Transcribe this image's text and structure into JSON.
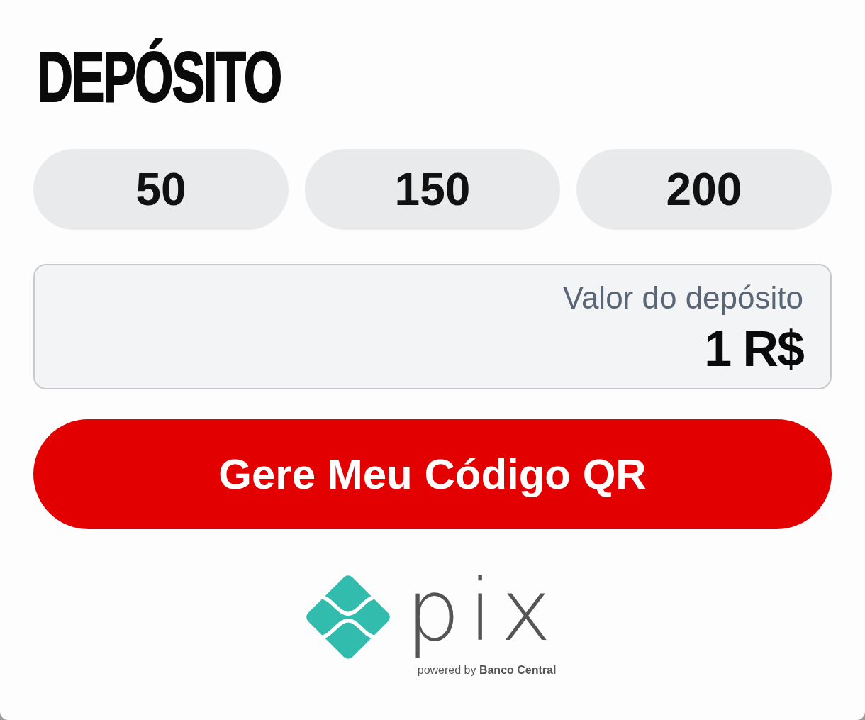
{
  "title": "DEPÓSITO",
  "amount_options": [
    {
      "label": "50",
      "selected": false
    },
    {
      "label": "150",
      "selected": false
    },
    {
      "label": "200",
      "selected": false
    }
  ],
  "amount_field": {
    "label": "Valor do depósito",
    "value": "1 R$"
  },
  "submit_button": {
    "label": "Gere Meu Código QR"
  },
  "footer_logo": {
    "wordmark": "pix",
    "tagline": "powered by **Banco Central**"
  }
}
